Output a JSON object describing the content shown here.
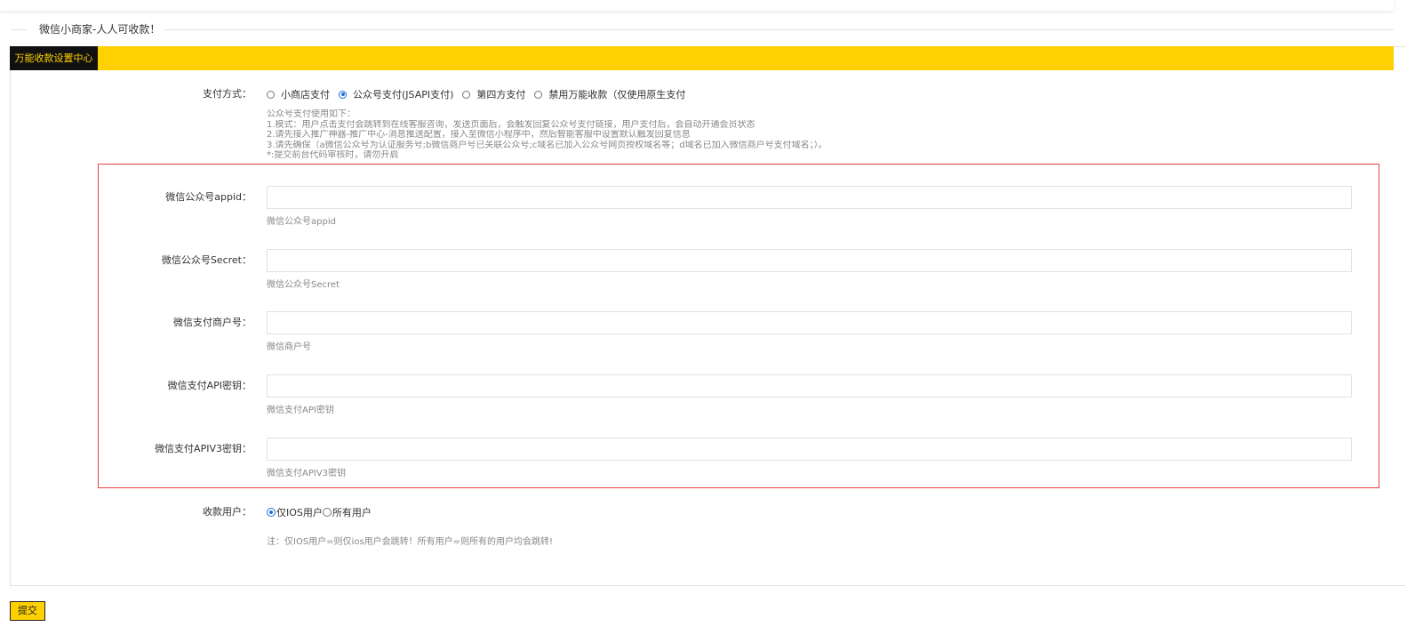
{
  "section": {
    "title": "微信小商家-人人可收款！"
  },
  "tabs": [
    {
      "label": "万能收款设置中心",
      "active": true
    }
  ],
  "payment_method": {
    "label": "支付方式：",
    "options": [
      "小商店支付",
      "公众号支付(JSAPI支付)",
      "第四方支付",
      "禁用万能收款（仅使用原生支付"
    ],
    "selected_index": 1,
    "help_lines": [
      "公众号支付使用如下：",
      "1.模式：用户点击支付会跳转到在线客服咨询，发送页面后，会触发回复公众号支付链接，用户支付后，会自动开通会员状态",
      "2.请先接入推广神器-推广中心-消息推送配置，接入至微信小程序中，然后智能客服中设置默认触发回复信息",
      "3.请先确保（a微信公众号为认证服务号;b微信商户号已关联公众号;c域名已加入公众号网页授权域名等；d域名已加入微信商户号支付域名；）。",
      "*:提交前台代码审核时，请勿开启"
    ]
  },
  "fields": [
    {
      "label": "微信公众号appid：",
      "value": "",
      "help": "微信公众号appid"
    },
    {
      "label": "微信公众号Secret：",
      "value": "",
      "help": "微信公众号Secret"
    },
    {
      "label": "微信支付商户号：",
      "value": "",
      "help": "微信商户号"
    },
    {
      "label": "微信支付API密钥：",
      "value": "",
      "help": "微信支付API密钥"
    },
    {
      "label": "微信支付APIV3密钥：",
      "value": "",
      "help": "微信支付APIV3密钥"
    }
  ],
  "payee": {
    "label": "收款用户：",
    "options": [
      "仅IOS用户",
      "所有用户"
    ],
    "selected_index": 0,
    "note": "注：仅IOS用户=则仅ios用户会跳转！所有用户=则所有的用户均会跳转!"
  },
  "submit": {
    "label": "提交"
  },
  "colors": {
    "accent": "#ffd100",
    "tab_active_bg": "#111111",
    "highlight_border": "#e8403f",
    "radio_checked": "#1e6fd9"
  }
}
